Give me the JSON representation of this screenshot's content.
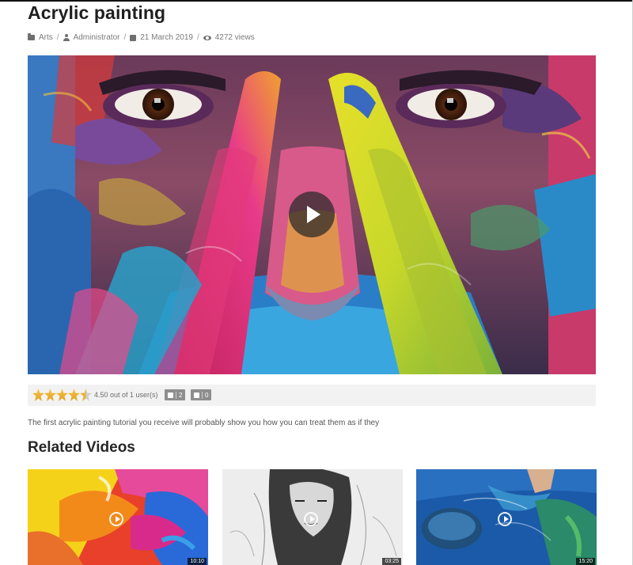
{
  "post": {
    "title": "Acrylic painting",
    "category": "Arts",
    "author": "Administrator",
    "date": "21 March 2019",
    "views": "4272 views",
    "separator": "/"
  },
  "video": {
    "play_icon": "play-icon"
  },
  "rating": {
    "value": 4.5,
    "max": 5,
    "text": "4.50 out of 1 user(s)",
    "likes": "2",
    "dislikes": "0"
  },
  "description": "The first acrylic painting tutorial you receive will probably show you how you can treat them as if they",
  "related": {
    "heading": "Related Videos",
    "items": [
      {
        "duration": "10:10"
      },
      {
        "duration": "03:25"
      },
      {
        "duration": "15:20"
      }
    ]
  },
  "colors": {
    "title": "#1f1f1f",
    "meta": "#7b7b7b",
    "rating_bg": "#f2f2f2",
    "star": "#f6c144",
    "vote_bg": "#8e8e8e"
  }
}
